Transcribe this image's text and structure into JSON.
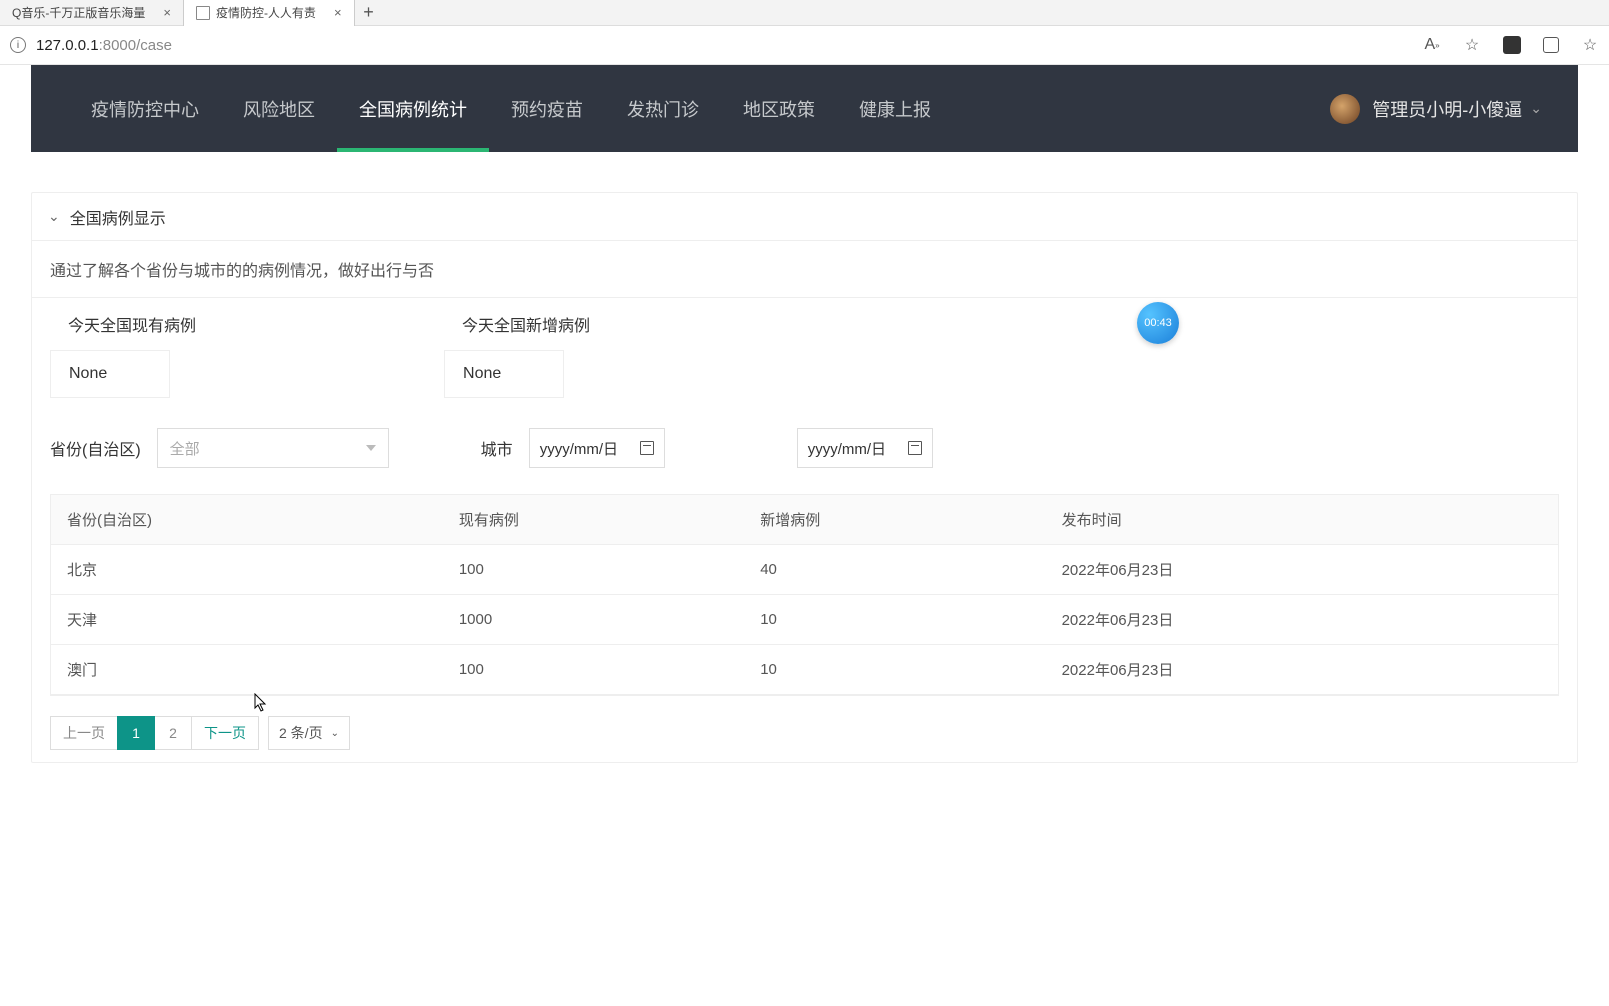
{
  "browser": {
    "tabs": [
      {
        "title": "Q音乐-千万正版音乐海量"
      },
      {
        "title": "疫情防控-人人有责"
      }
    ],
    "url_host": "127.0.0.1",
    "url_port": ":8000",
    "url_path": "/case"
  },
  "nav": {
    "items": [
      "疫情防控中心",
      "风险地区",
      "全国病例统计",
      "预约疫苗",
      "发热门诊",
      "地区政策",
      "健康上报"
    ],
    "active_index": 2,
    "user_label": "管理员小明-小傻逼"
  },
  "panel": {
    "title": "全国病例显示",
    "subtitle": "通过了解各个省份与城市的的病例情况，做好出行与否",
    "stat1_label": "今天全国现有病例",
    "stat1_value": "None",
    "stat2_label": "今天全国新增病例",
    "stat2_value": "None"
  },
  "filters": {
    "province_label": "省份(自治区)",
    "province_selected": "全部",
    "city_label": "城市",
    "date_placeholder": "yyyy/mm/日"
  },
  "table": {
    "headers": [
      "省份(自治区)",
      "现有病例",
      "新增病例",
      "发布时间"
    ],
    "rows": [
      [
        "北京",
        "100",
        "40",
        "2022年06月23日"
      ],
      [
        "天津",
        "1000",
        "10",
        "2022年06月23日"
      ],
      [
        "澳门",
        "100",
        "10",
        "2022年06月23日"
      ]
    ]
  },
  "pager": {
    "prev": "上一页",
    "pages": [
      "1",
      "2"
    ],
    "next": "下一页",
    "size_label": "2 条/页"
  },
  "timer": "00:43"
}
